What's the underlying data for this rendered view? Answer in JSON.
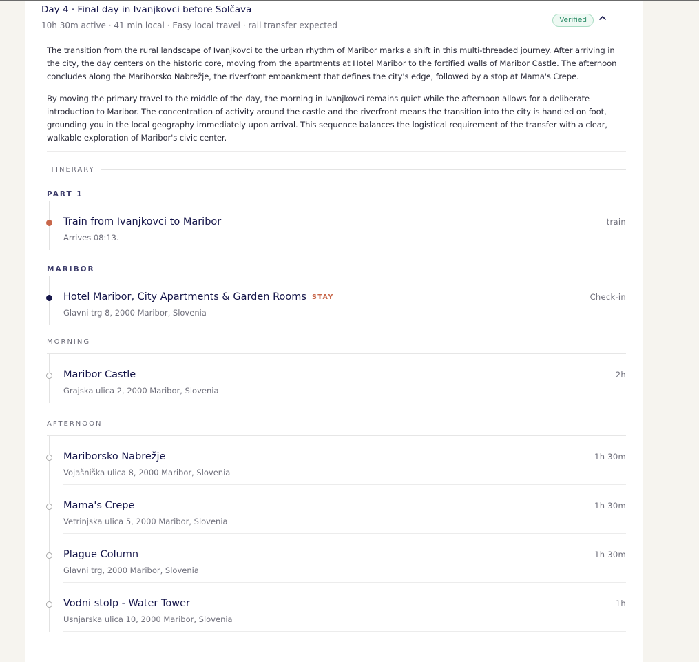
{
  "day": {
    "title": "Day 4 · Final day in Ivanjkovci before Solčava",
    "subtitle": "10h 30m active · 41 min local · Easy local travel · rail transfer expected",
    "badge": "Verified",
    "collapse_icon": "chevron-up-icon"
  },
  "description": [
    "The transition from the rural landscape of Ivanjkovci to the urban rhythm of Maribor marks a shift in this multi-threaded journey. After arriving in the city, the day centers on the historic core, moving from the apartments at Hotel Maribor to the fortified walls of Maribor Castle. The afternoon concludes along the Mariborsko Nabrežje, the riverfront embankment that defines the city's edge, followed by a stop at Mama's Crepe.",
    "By moving the primary travel to the middle of the day, the morning in Ivanjkovci remains quiet while the afternoon allows for a deliberate introduction to Maribor. The concentration of activity around the castle and the riverfront means the transition into the city is handled on foot, grounding you in the local geography immediately upon arrival. This sequence balances the logistical requirement of the transfer with a clear, walkable exploration of Maribor's civic center."
  ],
  "itinerary_label": "ITINERARY",
  "sections": {
    "part1": {
      "label": "PART 1",
      "items": [
        {
          "title": "Train from Ivanjkovci to Maribor",
          "meta": "Arrives 08:13.",
          "right": "train",
          "dot_color": "#c8674a"
        }
      ]
    },
    "maribor": {
      "label": "MARIBOR",
      "items": [
        {
          "title": "Hotel Maribor, City Apartments & Garden Rooms",
          "tag": "STAY",
          "meta": "Glavni trg 8, 2000 Maribor, Slovenia",
          "right": "Check-in",
          "dot_color": "#16164a"
        }
      ]
    },
    "morning": {
      "label": "MORNING",
      "items": [
        {
          "title": "Maribor Castle",
          "meta": "Grajska ulica 2, 2000 Maribor, Slovenia",
          "right": "2h"
        }
      ]
    },
    "afternoon": {
      "label": "AFTERNOON",
      "items": [
        {
          "title": "Mariborsko Nabrežje",
          "meta": "Vojašniška ulica 8, 2000 Maribor, Slovenia",
          "right": "1h 30m"
        },
        {
          "title": "Mama's Crepe",
          "meta": "Vetrinjska ulica 5, 2000 Maribor, Slovenia",
          "right": "1h 30m"
        },
        {
          "title": "Plague Column",
          "meta": "Glavni trg, 2000 Maribor, Slovenia",
          "right": "1h 30m"
        },
        {
          "title": "Vodni stolp - Water Tower",
          "meta": "Usnjarska ulica 10, 2000 Maribor, Slovenia",
          "right": "1h"
        }
      ]
    }
  }
}
